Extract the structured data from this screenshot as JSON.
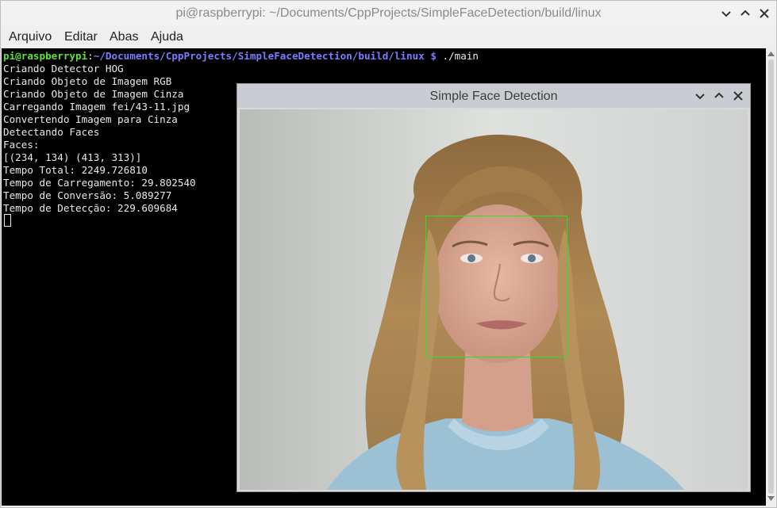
{
  "terminal_window": {
    "title": "pi@raspberrypi: ~/Documents/CppProjects/SimpleFaceDetection/build/linux",
    "menu": [
      "Arquivo",
      "Editar",
      "Abas",
      "Ajuda"
    ],
    "controls": [
      "minimize-icon",
      "maximize-icon",
      "close-icon"
    ]
  },
  "terminal": {
    "prompt_user": "pi@raspberrypi",
    "prompt_sep": ":",
    "prompt_path": "~/Documents/CppProjects/SimpleFaceDetection/build/linux",
    "prompt_dollar": " $",
    "command": " ./main",
    "output": [
      "Criando Detector HOG",
      "Criando Objeto de Imagem RGB",
      "Criando Objeto de Imagem Cinza",
      "Carregando Imagem fei/43-11.jpg",
      "Convertendo Imagem para Cinza",
      "Detectando Faces",
      "Faces:",
      "[(234, 134) (413, 313)]",
      "Tempo Total: 2249.726810",
      "Tempo de Carregamento: 29.802540",
      "Tempo de Conversão: 5.089277",
      "Tempo de Detecção: 229.609684"
    ]
  },
  "image_window": {
    "title": "Simple Face Detection",
    "controls": [
      "chevron-down-icon",
      "chevron-up-icon",
      "close-icon"
    ],
    "box_color": "#2be02b"
  },
  "colors": {
    "terminal_bg": "#000000",
    "prompt_user": "#5ee13a",
    "prompt_path": "#7b7bff",
    "text": "#e8e8e8"
  }
}
